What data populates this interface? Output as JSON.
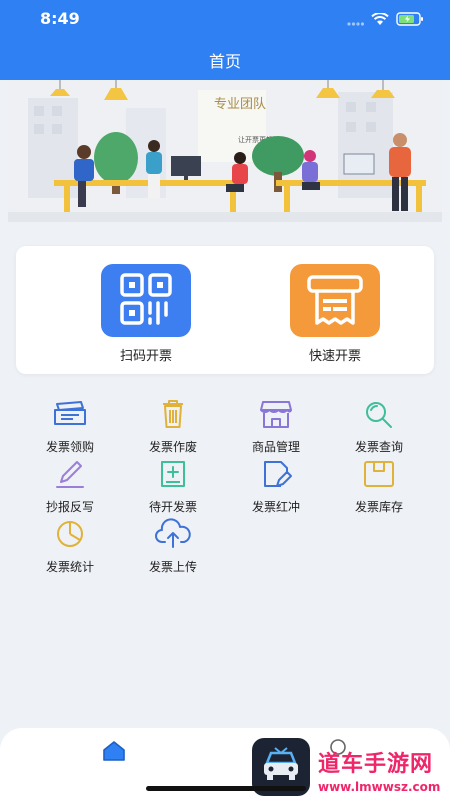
{
  "status_bar": {
    "time": "8:49"
  },
  "header": {
    "title": "首页"
  },
  "banner": {
    "sign_main": "专业团队",
    "sign_sub": "让开票更轻松"
  },
  "main_actions": [
    {
      "label": "扫码开票",
      "icon": "qr-code-icon",
      "color": "#3d7ef0"
    },
    {
      "label": "快速开票",
      "icon": "invoice-printer-icon",
      "color": "#f59a3b"
    }
  ],
  "functions": [
    {
      "label": "发票领购",
      "icon": "tickets-icon"
    },
    {
      "label": "发票作废",
      "icon": "trash-icon"
    },
    {
      "label": "商品管理",
      "icon": "store-icon"
    },
    {
      "label": "发票查询",
      "icon": "search-icon"
    },
    {
      "label": "抄报反写",
      "icon": "pencil-icon"
    },
    {
      "label": "待开发票",
      "icon": "pending-invoice-icon"
    },
    {
      "label": "发票红冲",
      "icon": "edit-document-icon"
    },
    {
      "label": "发票库存",
      "icon": "box-icon"
    },
    {
      "label": "发票统计",
      "icon": "pie-chart-icon"
    },
    {
      "label": "发票上传",
      "icon": "cloud-upload-icon"
    }
  ],
  "watermark": {
    "name": "道车手游网",
    "url": "www.lmwwsz.com"
  }
}
